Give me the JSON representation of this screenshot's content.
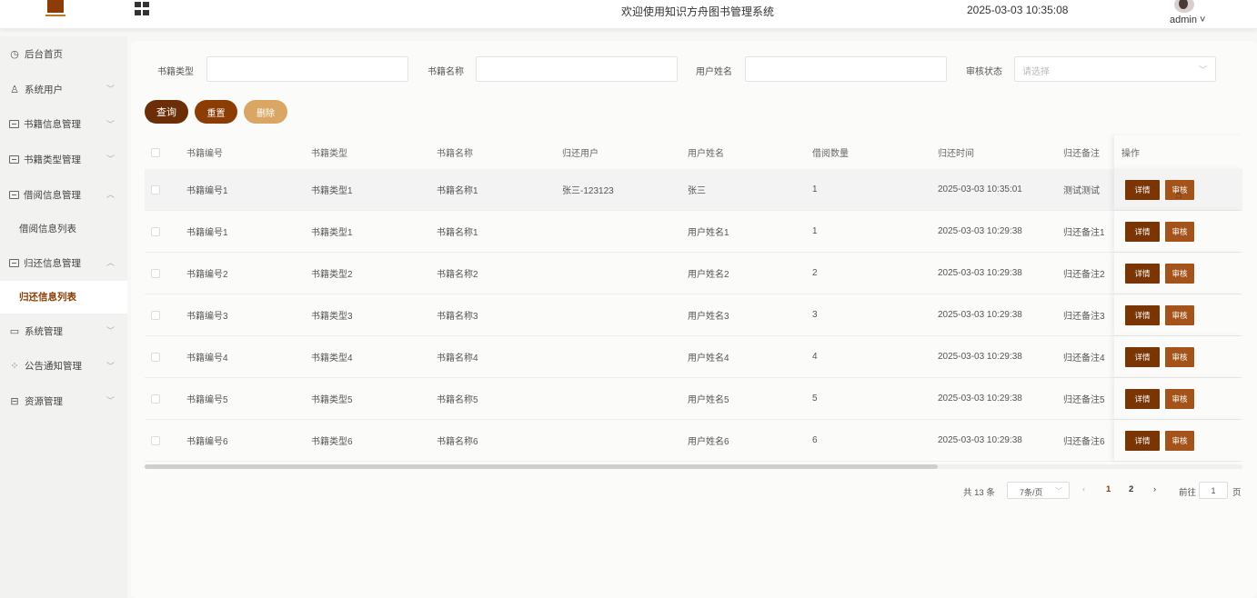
{
  "header": {
    "title": "欢迎使用知识方舟图书管理系统",
    "datetime": "2025-03-03 10:35:08",
    "user": "admin ˅"
  },
  "sidebar": {
    "items": [
      {
        "label": "后台首页",
        "icon": "clock-icon"
      },
      {
        "label": "系统用户",
        "icon": "user-icon",
        "arrow": "﹀"
      },
      {
        "label": "书籍信息管理",
        "icon": "box-icon",
        "arrow": "﹀"
      },
      {
        "label": "书籍类型管理",
        "icon": "box-icon",
        "arrow": "﹀"
      },
      {
        "label": "借阅信息管理",
        "icon": "box-icon",
        "arrow": "︿",
        "sub": "借阅信息列表"
      },
      {
        "label": "归还信息管理",
        "icon": "box-icon",
        "arrow": "︿",
        "sub": "归还信息列表"
      },
      {
        "label": "系统管理",
        "icon": "folder-icon",
        "arrow": "﹀"
      },
      {
        "label": "公告通知管理",
        "icon": "sparkle-icon",
        "arrow": "﹀"
      },
      {
        "label": "资源管理",
        "icon": "gift-icon",
        "arrow": "﹀"
      }
    ]
  },
  "filters": {
    "book_type_label": "书籍类型",
    "book_name_label": "书籍名称",
    "user_name_label": "用户姓名",
    "status_label": "审核状态",
    "status_placeholder": "请选择"
  },
  "buttons": {
    "query": "查询",
    "reset": "重置",
    "delete": "删除"
  },
  "table": {
    "headers": [
      "书籍编号",
      "书籍类型",
      "书籍名称",
      "归还用户",
      "用户姓名",
      "借阅数量",
      "归还时间",
      "归还备注",
      "操作"
    ],
    "rows": [
      [
        "书籍编号1",
        "书籍类型1",
        "书籍名称1",
        "张三-123123",
        "张三",
        "1",
        "2025-03-03 10:35:01",
        "测试测试"
      ],
      [
        "书籍编号1",
        "书籍类型1",
        "书籍名称1",
        "",
        "用户姓名1",
        "1",
        "2025-03-03 10:29:38",
        "归还备注1"
      ],
      [
        "书籍编号2",
        "书籍类型2",
        "书籍名称2",
        "",
        "用户姓名2",
        "2",
        "2025-03-03 10:29:38",
        "归还备注2"
      ],
      [
        "书籍编号3",
        "书籍类型3",
        "书籍名称3",
        "",
        "用户姓名3",
        "3",
        "2025-03-03 10:29:38",
        "归还备注3"
      ],
      [
        "书籍编号4",
        "书籍类型4",
        "书籍名称4",
        "",
        "用户姓名4",
        "4",
        "2025-03-03 10:29:38",
        "归还备注4"
      ],
      [
        "书籍编号5",
        "书籍类型5",
        "书籍名称5",
        "",
        "用户姓名5",
        "5",
        "2025-03-03 10:29:38",
        "归还备注5"
      ],
      [
        "书籍编号6",
        "书籍类型6",
        "书籍名称6",
        "",
        "用户姓名6",
        "6",
        "2025-03-03 10:29:38",
        "归还备注6"
      ]
    ],
    "detail_label": "详情",
    "audit_label": "审核"
  },
  "pagination": {
    "total": "共 13 条",
    "page_size": "7条/页",
    "prev": "‹",
    "pages": [
      "1",
      "2"
    ],
    "current_page": 1,
    "next": "›",
    "goto_label": "前往",
    "goto_value": "1",
    "page_suffix": "页"
  },
  "colors": {
    "primary": "#8b3d05",
    "query_button": "#6b2e07",
    "delete_button": "#d9a763",
    "audit_button": "#a4541a"
  }
}
